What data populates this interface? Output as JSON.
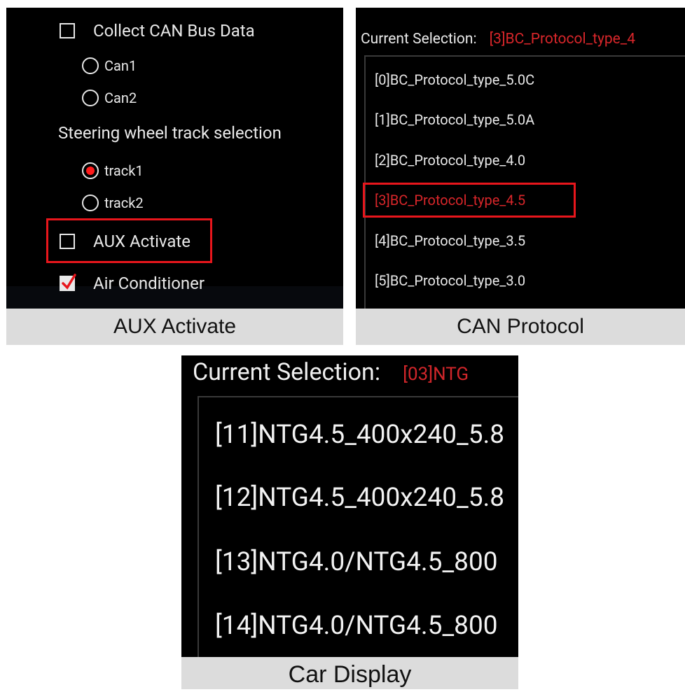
{
  "panel1": {
    "collect_can": {
      "label": "Collect CAN Bus Data",
      "checked": false
    },
    "can_options": [
      {
        "label": "Can1",
        "selected": false
      },
      {
        "label": "Can2",
        "selected": false
      }
    ],
    "steering_title": "Steering wheel track selection",
    "track_options": [
      {
        "label": "track1",
        "selected": true
      },
      {
        "label": "track2",
        "selected": false
      }
    ],
    "aux": {
      "label": "AUX Activate",
      "checked": false
    },
    "air": {
      "label": "Air Conditioner",
      "checked": true
    },
    "caption": "AUX Activate"
  },
  "panel2": {
    "current_label": "Current Selection:",
    "current_value": "[3]BC_Protocol_type_4",
    "items": [
      "[0]BC_Protocol_type_5.0C",
      "[1]BC_Protocol_type_5.0A",
      "[2]BC_Protocol_type_4.0",
      "[3]BC_Protocol_type_4.5",
      "[4]BC_Protocol_type_3.5",
      "[5]BC_Protocol_type_3.0"
    ],
    "selected_index": 3,
    "caption": "CAN Protocol"
  },
  "panel3": {
    "current_label": "Current Selection:",
    "current_value": "[03]NTG",
    "items": [
      "[11]NTG4.5_400x240_5.8",
      "[12]NTG4.5_400x240_5.8",
      "[13]NTG4.0/NTG4.5_800",
      "[14]NTG4.0/NTG4.5_800"
    ],
    "caption": "Car Display"
  },
  "colors": {
    "accent_red": "#e8161c",
    "panel_bg": "#000000",
    "caption_bg": "#dcdcdc"
  }
}
